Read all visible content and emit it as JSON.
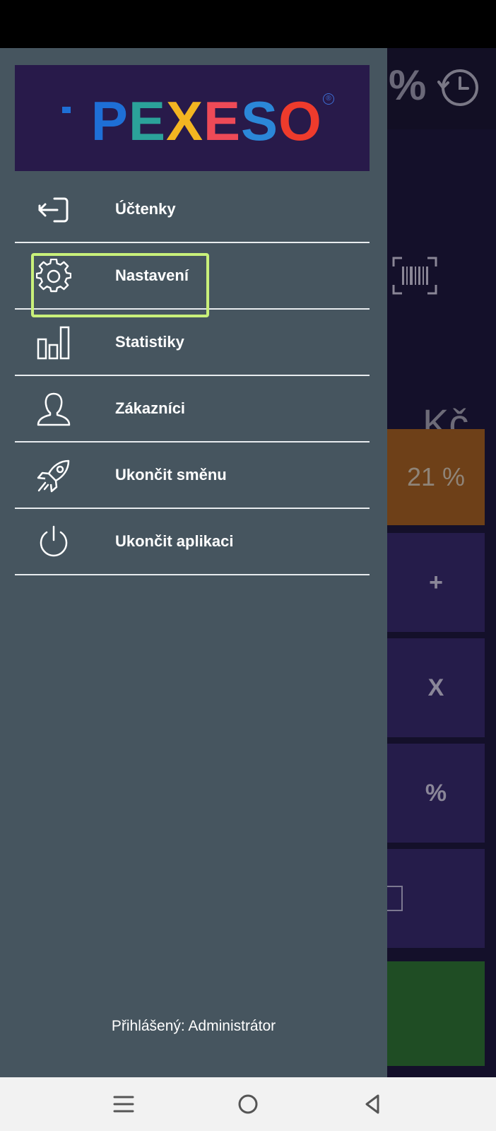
{
  "drawer": {
    "logo": {
      "letters": [
        {
          "char": "P",
          "color": "#1e6fd6"
        },
        {
          "char": "E",
          "color": "#2ba29a"
        },
        {
          "char": "X",
          "color": "#f3b521"
        },
        {
          "char": "E",
          "color": "#ee4a57"
        },
        {
          "char": "S",
          "color": "#2b87d8"
        },
        {
          "char": "O",
          "color": "#ee3b2c"
        }
      ],
      "registered": "®"
    },
    "menu": [
      {
        "label": "Účtenky",
        "icon": "receipt-exit-icon"
      },
      {
        "label": "Nastavení",
        "icon": "gear-icon"
      },
      {
        "label": "Statistiky",
        "icon": "bar-chart-icon"
      },
      {
        "label": "Zákazníci",
        "icon": "user-icon"
      },
      {
        "label": "Ukončit směnu",
        "icon": "rocket-icon"
      },
      {
        "label": "Ukončit aplikaci",
        "icon": "power-icon"
      }
    ],
    "highlighted_item": "Nastavení",
    "highlight_color": "#c9f07a",
    "footer": "Přihlášený: Administrátor"
  },
  "background_app": {
    "header_partial": "%",
    "currency": "Kč",
    "tiles": {
      "vat": "21 %",
      "plus": "+",
      "multiply": "X",
      "percent": "%"
    }
  },
  "nav_bar": {
    "buttons": [
      "menu-icon",
      "home-circle-icon",
      "back-triangle-icon"
    ]
  }
}
